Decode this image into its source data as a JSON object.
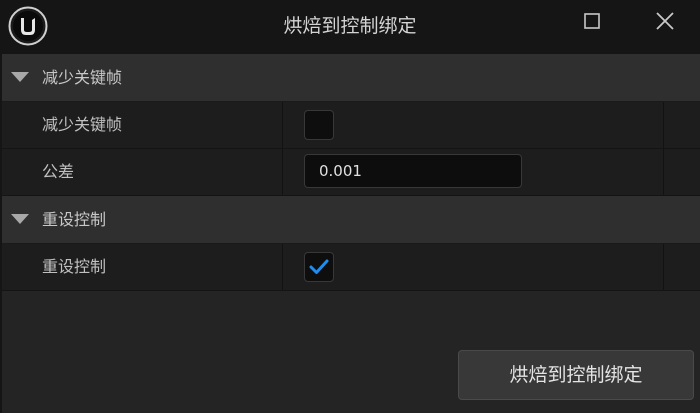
{
  "window": {
    "title": "烘焙到控制绑定",
    "logo_icon": "unreal-engine-logo-icon",
    "maximize_icon": "maximize-icon",
    "close_icon": "close-icon"
  },
  "categories": [
    {
      "label": "减少关键帧",
      "properties": [
        {
          "label": "减少关键帧",
          "type": "checkbox",
          "checked": false
        },
        {
          "label": "公差",
          "type": "number",
          "value": "0.001"
        }
      ]
    },
    {
      "label": "重设控制",
      "properties": [
        {
          "label": "重设控制",
          "type": "checkbox",
          "checked": true
        }
      ]
    }
  ],
  "footer": {
    "confirm_label": "烘焙到控制绑定"
  },
  "colors": {
    "check_accent": "#1e8cf0",
    "background": "#151515",
    "panel": "#242424"
  }
}
